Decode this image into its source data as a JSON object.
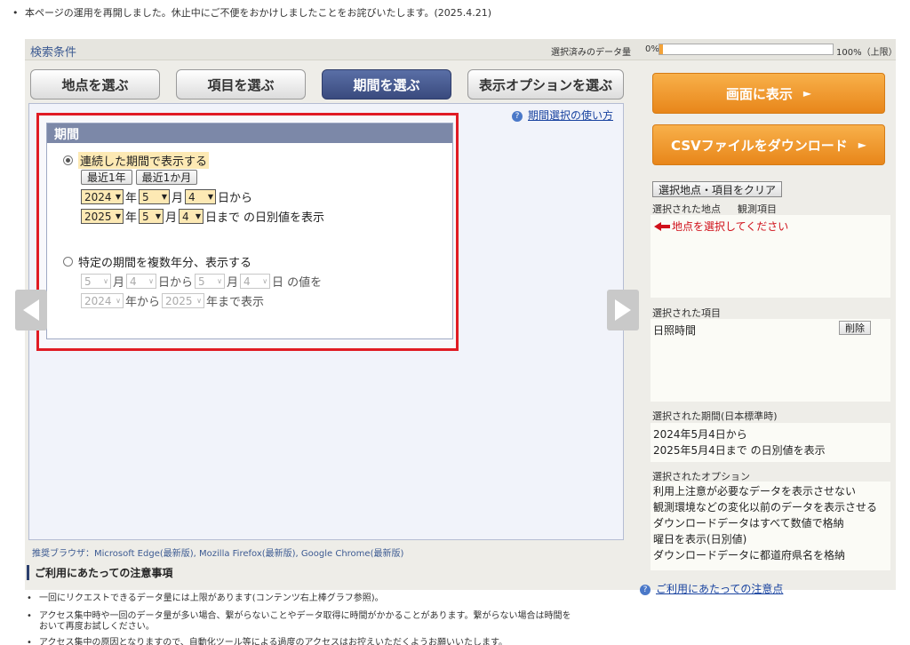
{
  "notice": "本ページの運用を再開しました。休止中にご不便をおかけしましたことをお詫びいたします。(2025.4.21)",
  "panel": {
    "title": "検索条件",
    "data_amount_label": "選択済みのデータ量",
    "data_amount_min": "0%",
    "data_amount_max": "100%（上限）",
    "data_amount_fill_fraction": 0.02
  },
  "tabs": [
    "地点を選ぶ",
    "項目を選ぶ",
    "期間を選ぶ",
    "表示オプションを選ぶ"
  ],
  "help_link": "期間選択の使い方",
  "period": {
    "header": "期間",
    "opt1_label": "連続した期間で表示する",
    "btn_last_year": "最近1年",
    "btn_last_month": "最近1か月",
    "from_year": "2024",
    "from_month": "5",
    "from_day": "4",
    "to_year": "2025",
    "to_month": "5",
    "to_day": "4",
    "unit_year": "年",
    "unit_month": "月",
    "unit_day_from": "日から",
    "unit_day_to": "日まで",
    "suffix_daily": "の日別値を表示",
    "opt2_label": "特定の期間を複数年分、表示する",
    "m_from": "5",
    "d_from": "4",
    "m_to": "5",
    "d_to": "4",
    "y_from": "2024",
    "y_to": "2025",
    "txt_month": "月",
    "txt_dayfrom": "日から",
    "txt_day": "日",
    "txt_value": "の値を",
    "txt_yearfrom": "年から",
    "txt_yearto": "年まで表示"
  },
  "side": {
    "show_button": "画面に表示",
    "csv_button": "CSVファイルをダウンロード",
    "clear_button": "選択地点・項目をクリア",
    "selected_station_label": "選択された地点",
    "observation_item_label": "観測項目",
    "station_warning": "地点を選択してください",
    "selected_items_label": "選択された項目",
    "selected_item": "日照時間",
    "delete_button": "削除",
    "selected_period_label": "選択された期間(日本標準時)",
    "period_line1": "2024年5月4日から",
    "period_line2": "2025年5月4日まで の日別値を表示",
    "selected_options_label": "選択されたオプション",
    "options": [
      "利用上注意が必要なデータを表示させない",
      "観測環境などの変化以前のデータを表示させる",
      "ダウンロードデータはすべて数値で格納",
      "曜日を表示(日別値)",
      "ダウンロードデータに都道府県名を格納"
    ]
  },
  "bottom_link": "ご利用にあたっての注意点",
  "browser_note": "推奨ブラウザ：Microsoft Edge(最新版), Mozilla Firefox(最新版), Google Chrome(最新版)",
  "notes_title": "ご利用にあたっての注意事項",
  "notes": [
    "一回にリクエストできるデータ量には上限があります(コンテンツ右上棒グラフ参照)。",
    "アクセス集中時や一回のデータ量が多い場合、繋がらないことやデータ取得に時間がかかることがあります。繋がらない場合は時間を",
    "おいて再度お試しください。",
    "アクセス集中の原因となりますので、自動化ツール等による過度のアクセスはお控えいただくようお願いいたします。"
  ]
}
